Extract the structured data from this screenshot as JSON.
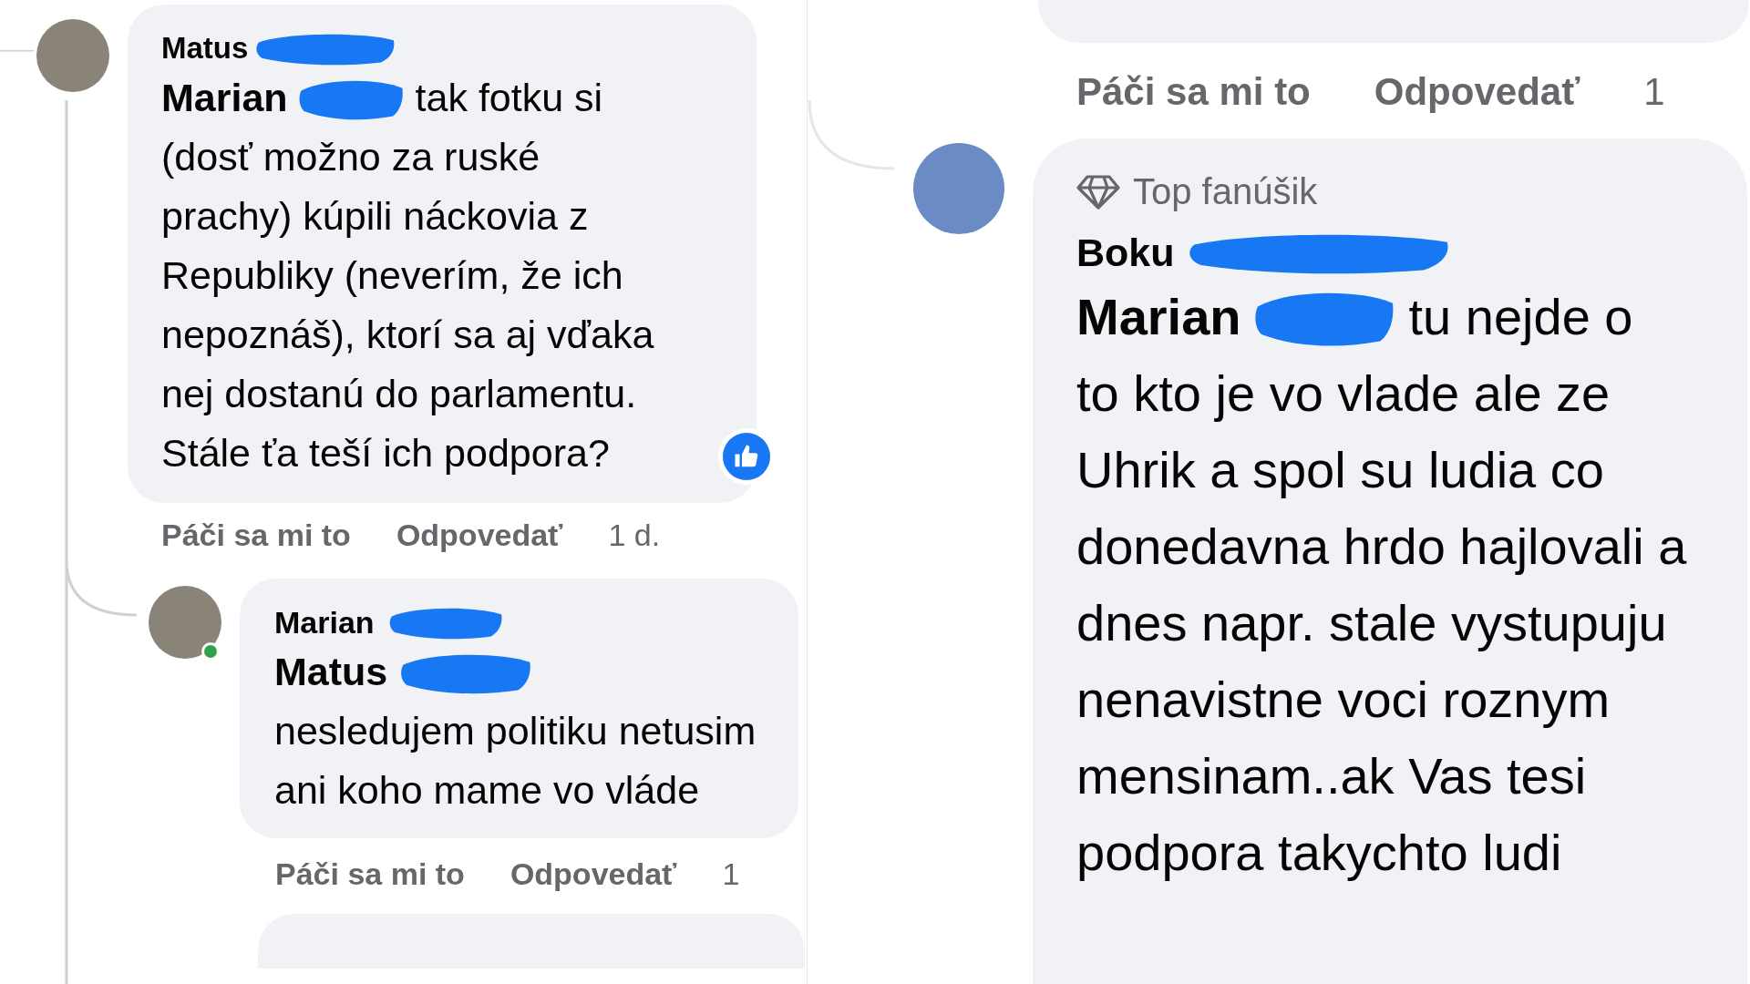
{
  "left_thread": {
    "comment": {
      "author": "Matus",
      "mention": "Marian",
      "first_line": "tak fotku si",
      "text": "(dosť možno za ruské prachy) kúpili náckovia z Republiky (neverím, že ich nepoznáš), ktorí sa aj vďaka nej dostanú do parlamentu. Stále ťa teší ich podpora?",
      "liked": true,
      "actions": [
        "Páči sa mi to",
        "Odpovedať"
      ],
      "time": "1 d."
    },
    "reply": {
      "author": "Marian",
      "mention": "Matus",
      "text": "nesledujem politiku netusim ani koho mame vo vláde",
      "online": true,
      "actions": [
        "Páči sa mi to",
        "Odpovedať"
      ],
      "time": "1"
    }
  },
  "right_thread": {
    "previous_actions": [
      "Páči sa mi to",
      "Odpovedať"
    ],
    "previous_time": "1",
    "comment": {
      "badge": "Top fanúšik",
      "author": "Boku",
      "mention": "Marian",
      "first_line": "tu nejde o",
      "text": "to kto je vo vlade ale ze Uhrik a spol su ludia co donedavna hrdo hajlovali a dnes napr. stale vystupuju nenavistne voci roznym mensinam..ak Vas tesi podpora takychto ludi"
    }
  }
}
